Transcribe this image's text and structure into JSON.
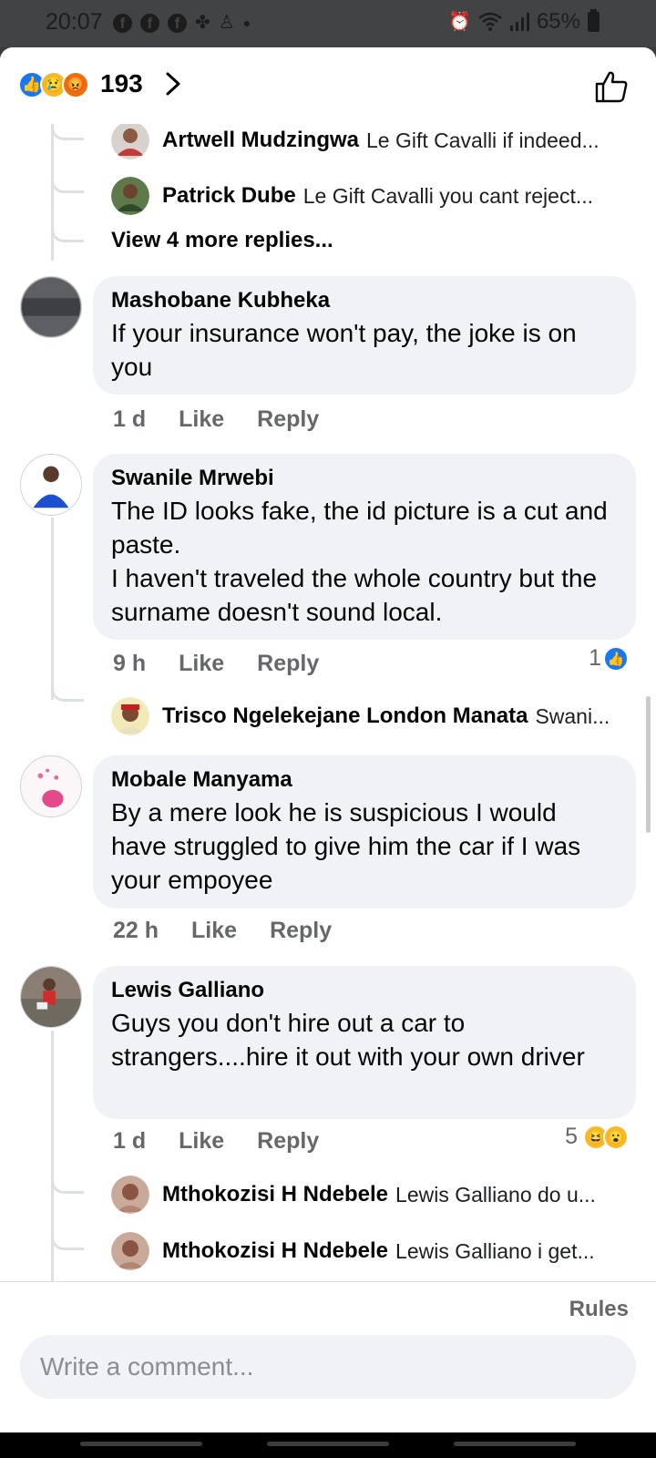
{
  "status_bar": {
    "time": "20:07",
    "battery": "65%"
  },
  "header": {
    "reaction_count": "193"
  },
  "top_replies": [
    {
      "name": "Artwell Mudzingwa",
      "text": "Le Gift Cavalli if indeed..."
    },
    {
      "name": "Patrick Dube",
      "text": "Le Gift Cavalli you cant reject..."
    }
  ],
  "view_more": "View 4 more replies...",
  "comments": [
    {
      "name": "Mashobane Kubheka",
      "text": "If your insurance won't pay, the joke is on you",
      "time": "1 d",
      "like": "Like",
      "reply": "Reply"
    },
    {
      "name": "Swanile Mrwebi",
      "text": "The ID looks fake, the id picture is a cut and paste.\nI haven't traveled the whole country but the surname doesn't sound local.",
      "time": "9 h",
      "like": "Like",
      "reply": "Reply",
      "reaction_count": "1",
      "replies": [
        {
          "name": "Trisco Ngelekejane London Manata",
          "text": "Swani..."
        }
      ]
    },
    {
      "name": "Mobale Manyama",
      "text": "By a mere look he is suspicious I would have struggled to give him the car if I was your empoyee",
      "time": "22 h",
      "like": "Like",
      "reply": "Reply"
    },
    {
      "name": "Lewis Galliano",
      "text": "Guys you don't hire out a car to strangers....hire it out with your own driver",
      "time": "1 d",
      "like": "Like",
      "reply": "Reply",
      "reaction_count": "5",
      "replies": [
        {
          "name": "Mthokozisi H Ndebele",
          "text": "Lewis Galliano do u..."
        },
        {
          "name": "Mthokozisi H Ndebele",
          "text": "Lewis Galliano i get..."
        }
      ]
    }
  ],
  "composer": {
    "rules": "Rules",
    "placeholder": "Write a comment..."
  },
  "colors": {
    "accent": "#1877f2",
    "bubble": "#f0f2f5",
    "muted": "#65676b"
  }
}
